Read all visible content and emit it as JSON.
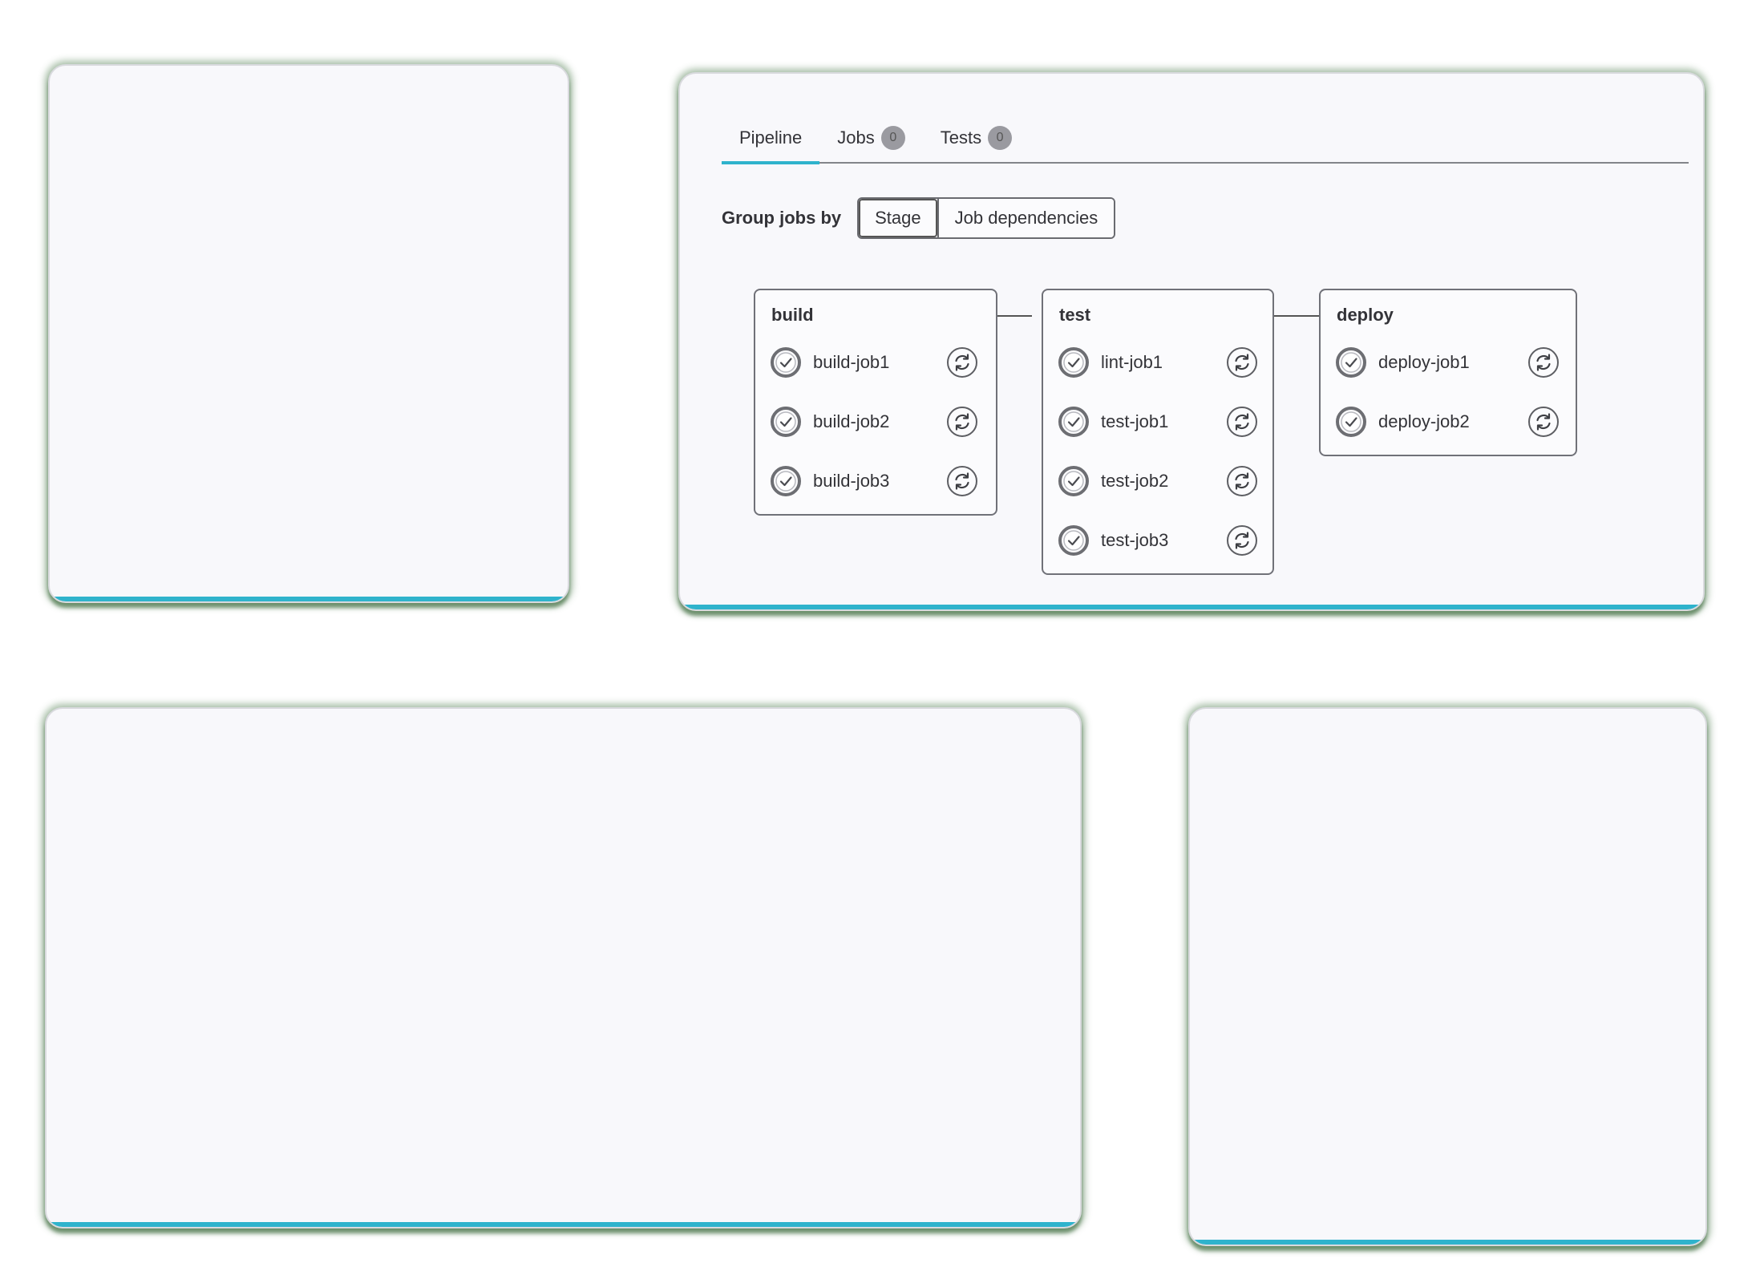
{
  "tabs": [
    {
      "label": "Pipeline"
    },
    {
      "label": "Jobs",
      "badge": "0"
    },
    {
      "label": "Tests",
      "badge": "0"
    }
  ],
  "group_by": {
    "label": "Group jobs by",
    "options": [
      "Stage",
      "Job dependencies"
    ],
    "selected": "Stage"
  },
  "stages": [
    {
      "name": "build",
      "jobs": [
        "build-job1",
        "build-job2",
        "build-job3"
      ]
    },
    {
      "name": "test",
      "jobs": [
        "lint-job1",
        "test-job1",
        "test-job2",
        "test-job3"
      ]
    },
    {
      "name": "deploy",
      "jobs": [
        "deploy-job1",
        "deploy-job2"
      ]
    }
  ],
  "icons": {
    "job_status": "success-check-circle-icon",
    "job_action": "retry-icon"
  },
  "colors": {
    "accent": "#2fb3cc",
    "card_glow": "#3c6e3c"
  }
}
